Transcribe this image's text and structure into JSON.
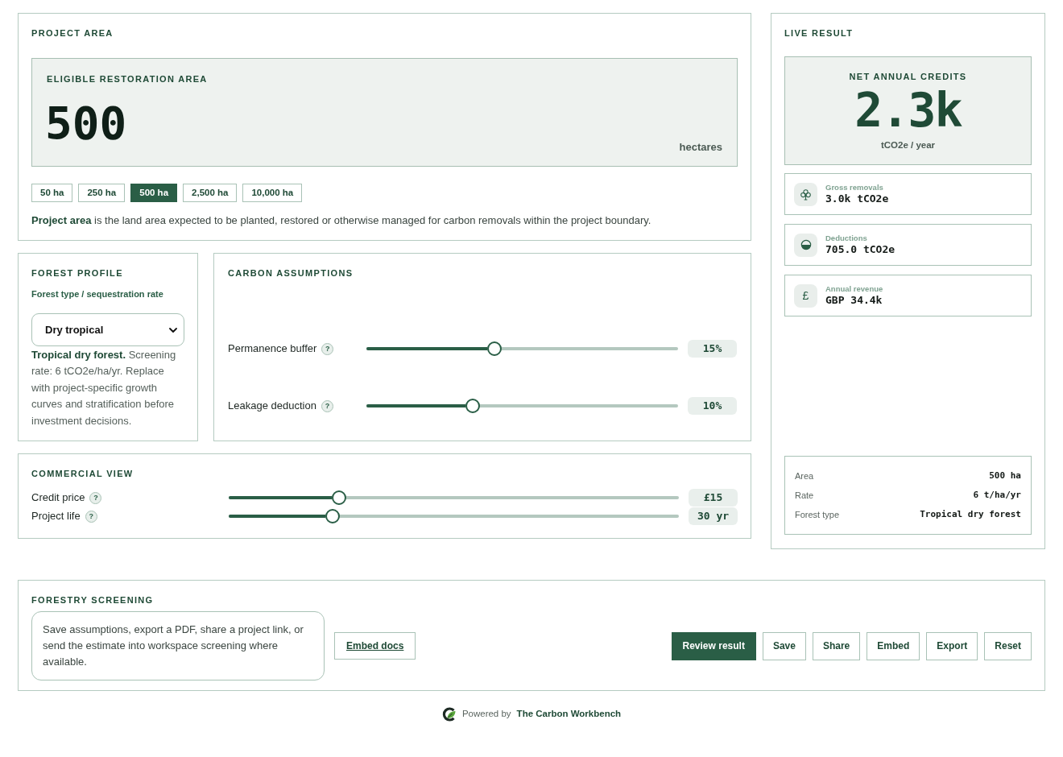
{
  "project_area": {
    "title": "PROJECT AREA",
    "display": {
      "label": "ELIGIBLE RESTORATION AREA",
      "value": "500",
      "unit": "hectares"
    },
    "presets": [
      {
        "label": "50 ha",
        "selected": false
      },
      {
        "label": "250 ha",
        "selected": false
      },
      {
        "label": "500 ha",
        "selected": true
      },
      {
        "label": "2,500 ha",
        "selected": false
      },
      {
        "label": "10,000 ha",
        "selected": false
      }
    ],
    "note": "**Project area** is the land area expected to be planted, restored or otherwise managed for carbon removals within the project boundary."
  },
  "forest_profile": {
    "title": "FOREST PROFILE",
    "field_label": "Forest type / sequestration rate",
    "forest_type": {
      "value": "Dry tropical"
    },
    "description": "**Tropical dry forest.** Screening rate: 6 tCO2e/ha/yr. Replace with project-specific growth curves and stratification before investment decisions."
  },
  "carbon_assumptions": {
    "title": "CARBON ASSUMPTIONS",
    "sliders": [
      {
        "label": "Permanence buffer",
        "hint": "?",
        "level": 0.41,
        "reading": "15%"
      },
      {
        "label": "Leakage deduction",
        "hint": "?",
        "level": 0.34,
        "reading": "10%"
      }
    ]
  },
  "commercial_view": {
    "title": "COMMERCIAL VIEW",
    "sliders": [
      {
        "label": "Credit price",
        "hint": "?",
        "level": 0.245,
        "reading": "£15"
      },
      {
        "label": "Project life",
        "hint": "?",
        "level": 0.23,
        "reading": "30 yr"
      }
    ]
  },
  "live_result": {
    "title": "LIVE RESULT",
    "headline": {
      "label": "NET ANNUAL CREDITS",
      "value": "2.3k",
      "unit": "tCO2e / year"
    },
    "metrics": [
      {
        "kind": "tree",
        "label": "Gross removals",
        "value": "3.0k tCO2e"
      },
      {
        "kind": "gauge",
        "label": "Deductions",
        "value": "705.0 tCO2e"
      },
      {
        "kind": "currency",
        "symbol": "£",
        "label": "Annual revenue",
        "value": "GBP 34.4k"
      }
    ],
    "summary": [
      {
        "label": "Area",
        "value": "500 ha"
      },
      {
        "label": "Rate",
        "value": "6 t/ha/yr"
      },
      {
        "label": "Forest type",
        "value": "Tropical dry forest"
      }
    ]
  },
  "forestry_screening": {
    "title": "FORESTRY SCREENING",
    "note": "Save assumptions, export a PDF, share a project link, or send the estimate into workspace screening where available.",
    "docs_link": "Embed docs",
    "actions": [
      {
        "label": "Review result",
        "primary": true
      },
      {
        "label": "Save",
        "primary": false
      },
      {
        "label": "Share",
        "primary": false
      },
      {
        "label": "Embed",
        "primary": false
      },
      {
        "label": "Export",
        "primary": false
      },
      {
        "label": "Reset",
        "primary": false
      }
    ]
  },
  "footer": {
    "prefix": "Powered by",
    "brand": "The Carbon Workbench"
  }
}
